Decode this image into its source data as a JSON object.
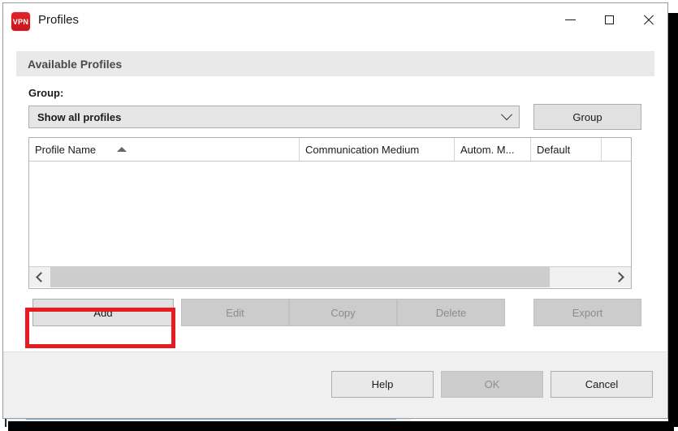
{
  "window": {
    "title": "Profiles",
    "icon_name": "vpn-app-icon",
    "icon_text": "VPN",
    "accent_red": "#c9161d",
    "controls": {
      "minimize": "minimize-icon",
      "maximize": "maximize-icon",
      "close": "close-icon"
    }
  },
  "section": {
    "header": "Available Profiles"
  },
  "group": {
    "label": "Group:",
    "selected": "Show all profiles",
    "dropdown_icon": "chevron-down-icon",
    "button": "Group"
  },
  "table": {
    "columns": [
      {
        "label": "Profile Name",
        "sort": "ascending"
      },
      {
        "label": "Communication Medium",
        "sort": ""
      },
      {
        "label": "Autom. M...",
        "sort": ""
      },
      {
        "label": "Default",
        "sort": ""
      },
      {
        "label": "",
        "sort": ""
      }
    ],
    "rows": [],
    "scrollbar": {
      "left_icon": "chevron-left-icon",
      "right_icon": "chevron-right-icon"
    }
  },
  "actions": [
    {
      "label": "Add",
      "enabled": true
    },
    {
      "label": "Edit",
      "enabled": false
    },
    {
      "label": "Copy",
      "enabled": false
    },
    {
      "label": "Delete",
      "enabled": false
    },
    {
      "label": "Export",
      "enabled": false
    }
  ],
  "footer": {
    "help": "Help",
    "ok": "OK",
    "cancel": "Cancel"
  },
  "annotation": {
    "target": "Add",
    "color": "#e81b23"
  }
}
